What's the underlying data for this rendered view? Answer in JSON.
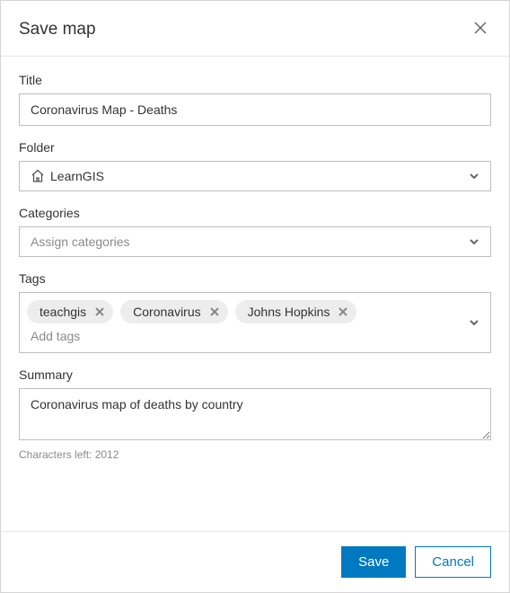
{
  "modal": {
    "title": "Save map"
  },
  "fields": {
    "title": {
      "label": "Title",
      "value": "Coronavirus Map - Deaths"
    },
    "folder": {
      "label": "Folder",
      "value": "LearnGIS"
    },
    "categories": {
      "label": "Categories",
      "placeholder": "Assign categories"
    },
    "tags": {
      "label": "Tags",
      "items": [
        "teachgis",
        "Coronavirus",
        "Johns Hopkins"
      ],
      "placeholder": "Add tags"
    },
    "summary": {
      "label": "Summary",
      "value": "Coronavirus map of deaths by country",
      "char_count": "Characters left: 2012"
    }
  },
  "footer": {
    "save": "Save",
    "cancel": "Cancel"
  }
}
